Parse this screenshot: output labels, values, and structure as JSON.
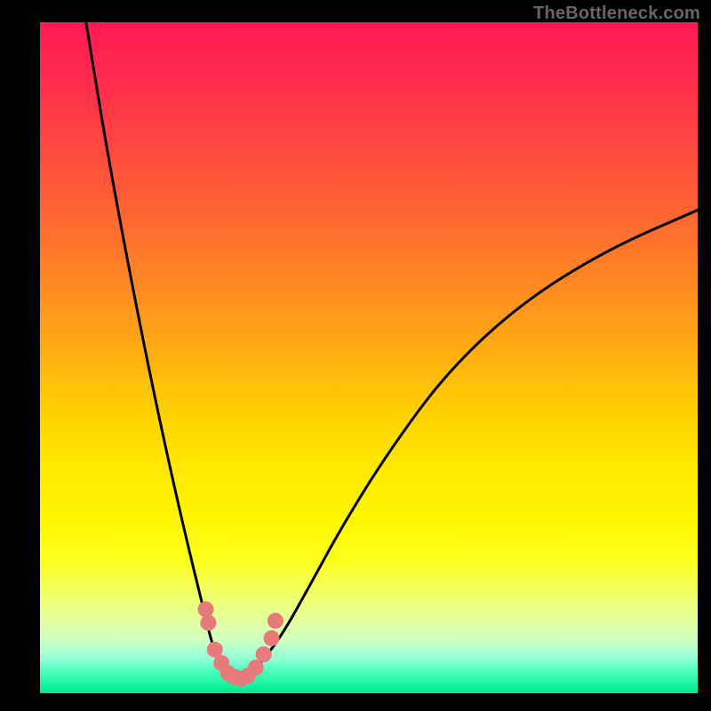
{
  "watermark": "TheBottleneck.com",
  "chart_data": {
    "type": "line",
    "title": "",
    "xlabel": "",
    "ylabel": "",
    "xlim": [
      0,
      100
    ],
    "ylim": [
      0,
      100
    ],
    "grid": false,
    "legend": false,
    "series": [
      {
        "name": "bottleneck-curve",
        "color": "#000000",
        "x": [
          7,
          10,
          13,
          16,
          19,
          22,
          25,
          26,
          27,
          28,
          29,
          30,
          31,
          32,
          34,
          37,
          41,
          46,
          53,
          62,
          73,
          86,
          100
        ],
        "y": [
          100,
          82,
          66,
          51,
          37,
          24,
          12,
          8,
          5,
          3,
          2,
          2,
          2,
          3,
          5,
          9,
          16,
          25,
          36,
          48,
          58,
          66,
          72
        ]
      }
    ],
    "markers": {
      "name": "highlight-dots",
      "color": "#e77a7a",
      "points": [
        {
          "x": 25.2,
          "y": 12.5
        },
        {
          "x": 25.6,
          "y": 10.5
        },
        {
          "x": 26.6,
          "y": 6.5
        },
        {
          "x": 27.6,
          "y": 4.5
        },
        {
          "x": 28.6,
          "y": 3.0
        },
        {
          "x": 29.6,
          "y": 2.4
        },
        {
          "x": 30.6,
          "y": 2.2
        },
        {
          "x": 31.6,
          "y": 2.6
        },
        {
          "x": 32.8,
          "y": 3.8
        },
        {
          "x": 34.0,
          "y": 5.8
        },
        {
          "x": 35.2,
          "y": 8.2
        },
        {
          "x": 35.8,
          "y": 10.8
        }
      ]
    },
    "background_gradient": {
      "top": "#ff1a52",
      "mid": "#ffd000",
      "bottom": "#00e88c"
    }
  }
}
